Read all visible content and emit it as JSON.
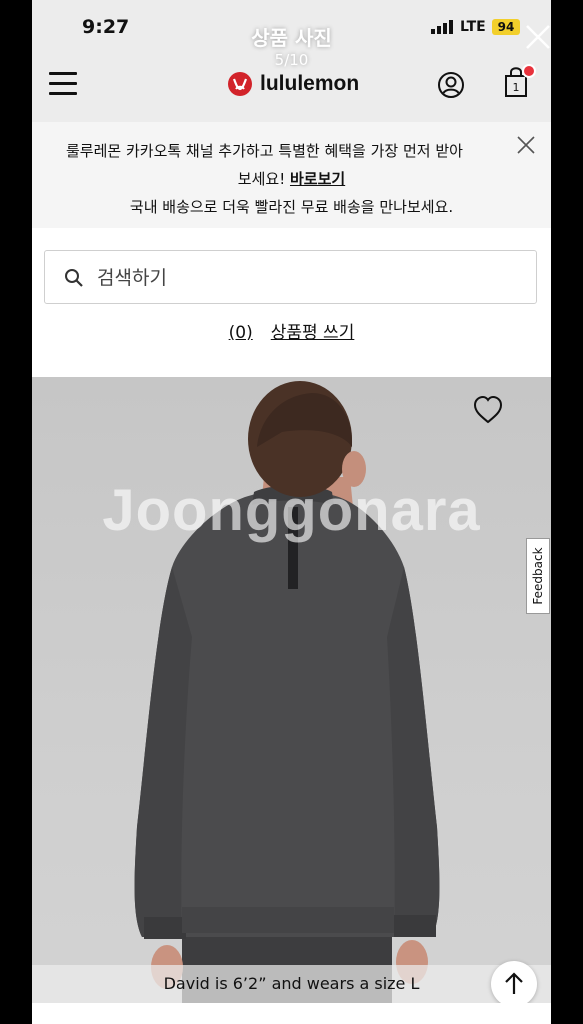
{
  "viewer": {
    "title": "상품 사진",
    "counter": "5/10"
  },
  "status": {
    "time": "9:27",
    "network": "LTE",
    "battery": "94"
  },
  "header": {
    "logo_text": "lululemon",
    "cart_count": "1"
  },
  "promo": {
    "line1": "룰루레몬 카카오톡 채널 추가하고 특별한 혜택을 가장 먼저 받아",
    "line2_prefix": "보세요! ",
    "line2_link": "바로보기",
    "line3": "국내 배송으로 더욱 빨라진 무료 배송을 만나보세요."
  },
  "search": {
    "placeholder": "검색하기"
  },
  "reviews": {
    "count": "(0)",
    "write_label": "상품평 쓰기"
  },
  "product_image": {
    "watermark": "Joonggonara",
    "caption": "David is 6’2” and wears a size L",
    "feedback_label": "Feedback"
  },
  "colors": {
    "brand_red": "#d2232a",
    "battery_yellow": "#f2cf2b"
  }
}
